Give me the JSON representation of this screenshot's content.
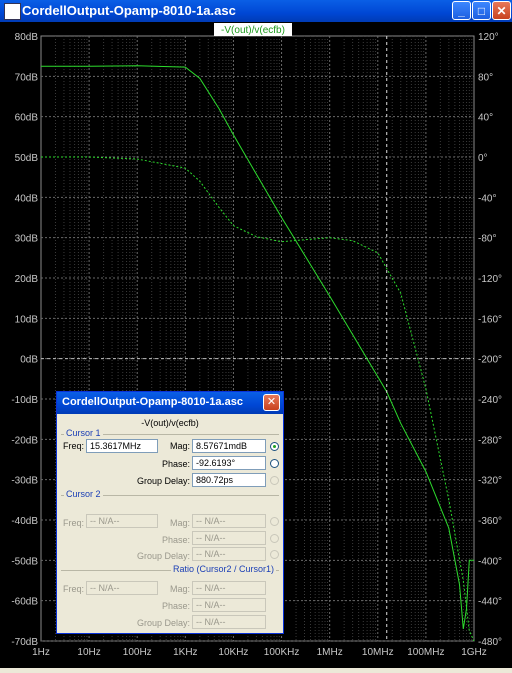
{
  "window": {
    "title": "CordellOutput-Opamp-8010-1a.asc",
    "minimize": "_",
    "maximize": "□",
    "close": "✕",
    "icon": "app-icon"
  },
  "plot": {
    "trace_label": "-V(out)/v(ecfb)",
    "colors": {
      "trace": "#2ddc2d",
      "grid": "#6a6a6a",
      "axis_text": "#c8c8c8",
      "background": "#000000",
      "trace_label_bg": "#ffffff"
    },
    "y_left_ticks": [
      "80dB",
      "70dB",
      "60dB",
      "50dB",
      "40dB",
      "30dB",
      "20dB",
      "10dB",
      "0dB",
      "-10dB",
      "-20dB",
      "-30dB",
      "-40dB",
      "-50dB",
      "-60dB",
      "-70dB"
    ],
    "y_right_ticks": [
      "120°",
      "80°",
      "40°",
      "0°",
      "-40°",
      "-80°",
      "-120°",
      "-160°",
      "-200°",
      "-240°",
      "-280°",
      "-320°",
      "-360°",
      "-400°",
      "-440°",
      "-480°"
    ],
    "x_ticks": [
      "1Hz",
      "10Hz",
      "100Hz",
      "1KHz",
      "10KHz",
      "100KHz",
      "1MHz",
      "10MHz",
      "100MHz",
      "1GHz"
    ]
  },
  "chart_data": {
    "type": "line",
    "title": "-V(out)/v(ecfb)",
    "xscale": "log",
    "xlim": [
      1,
      1000000000
    ],
    "ylim_left": [
      -70,
      80
    ],
    "ylim_right": [
      -480,
      120
    ],
    "grid": true,
    "cursor_x": 15361700,
    "series": [
      {
        "axis": "left",
        "style": "solid",
        "x": [
          1,
          10,
          100,
          1000,
          2000,
          5000,
          10000,
          100000,
          1000000,
          10000000,
          15361700,
          30000000,
          100000000,
          300000000,
          500000000,
          600000000,
          700000000,
          800000000,
          1000000000
        ],
        "y": [
          72.5,
          72.5,
          72.6,
          72.3,
          69.5,
          62,
          55.5,
          35,
          15.5,
          -4.5,
          -8.2,
          -16,
          -28,
          -42,
          -56,
          -67,
          -62,
          -50,
          -50
        ]
      },
      {
        "axis": "right",
        "style": "dashed",
        "x": [
          1,
          10,
          100,
          1000,
          2000,
          5000,
          10000,
          30000,
          100000,
          1000000,
          3000000,
          10000000,
          30000000,
          100000000,
          300000000,
          600000000,
          800000000,
          1000000000
        ],
        "y": [
          0,
          0,
          -2,
          -11,
          -24,
          -50,
          -68,
          -79,
          -84,
          -80,
          -83,
          -95,
          -135,
          -230,
          -340,
          -420,
          -470,
          -480
        ]
      }
    ]
  },
  "cursor_dialog": {
    "title": "CordellOutput-Opamp-8010-1a.asc",
    "close": "✕",
    "expression": "-V(out)/v(ecfb)",
    "cursor1": {
      "label": "Cursor 1",
      "freq_label": "Freq:",
      "freq": "15.3617MHz",
      "mag_label": "Mag:",
      "mag": "8.57671mdB",
      "phase_label": "Phase:",
      "phase": "-92.6193°",
      "group_delay_label": "Group Delay:",
      "group_delay": "880.72ps"
    },
    "cursor2": {
      "label": "Cursor 2",
      "freq_label": "Freq:",
      "freq": "-- N/A--",
      "mag_label": "Mag:",
      "mag": "-- N/A--",
      "phase_label": "Phase:",
      "phase": "-- N/A--",
      "group_delay_label": "Group Delay:",
      "group_delay": "-- N/A--"
    },
    "ratio": {
      "label": "Ratio (Cursor2 / Cursor1)",
      "freq_label": "Freq:",
      "freq": "-- N/A--",
      "mag_label": "Mag:",
      "mag": "-- N/A--",
      "phase_label": "Phase:",
      "phase": "-- N/A--",
      "group_delay_label": "Group Delay:",
      "group_delay": "-- N/A--"
    }
  }
}
